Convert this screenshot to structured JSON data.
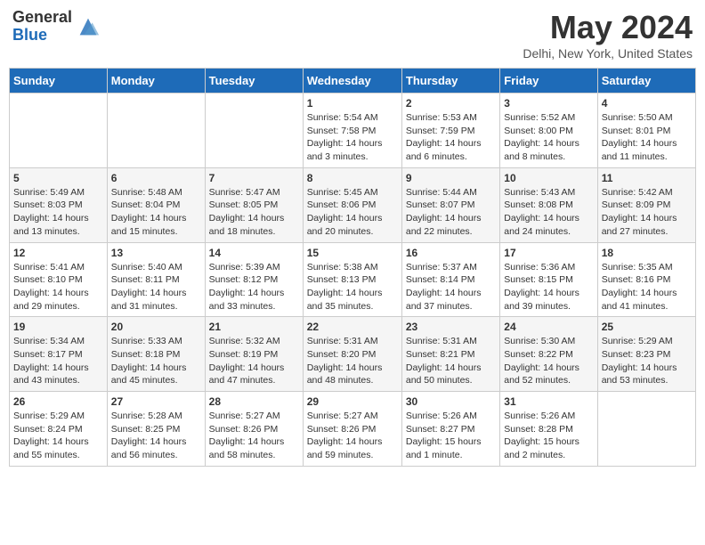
{
  "header": {
    "logo_general": "General",
    "logo_blue": "Blue",
    "month_title": "May 2024",
    "location": "Delhi, New York, United States"
  },
  "days_of_week": [
    "Sunday",
    "Monday",
    "Tuesday",
    "Wednesday",
    "Thursday",
    "Friday",
    "Saturday"
  ],
  "weeks": [
    [
      {
        "day": "",
        "info": ""
      },
      {
        "day": "",
        "info": ""
      },
      {
        "day": "",
        "info": ""
      },
      {
        "day": "1",
        "info": "Sunrise: 5:54 AM\nSunset: 7:58 PM\nDaylight: 14 hours\nand 3 minutes."
      },
      {
        "day": "2",
        "info": "Sunrise: 5:53 AM\nSunset: 7:59 PM\nDaylight: 14 hours\nand 6 minutes."
      },
      {
        "day": "3",
        "info": "Sunrise: 5:52 AM\nSunset: 8:00 PM\nDaylight: 14 hours\nand 8 minutes."
      },
      {
        "day": "4",
        "info": "Sunrise: 5:50 AM\nSunset: 8:01 PM\nDaylight: 14 hours\nand 11 minutes."
      }
    ],
    [
      {
        "day": "5",
        "info": "Sunrise: 5:49 AM\nSunset: 8:03 PM\nDaylight: 14 hours\nand 13 minutes."
      },
      {
        "day": "6",
        "info": "Sunrise: 5:48 AM\nSunset: 8:04 PM\nDaylight: 14 hours\nand 15 minutes."
      },
      {
        "day": "7",
        "info": "Sunrise: 5:47 AM\nSunset: 8:05 PM\nDaylight: 14 hours\nand 18 minutes."
      },
      {
        "day": "8",
        "info": "Sunrise: 5:45 AM\nSunset: 8:06 PM\nDaylight: 14 hours\nand 20 minutes."
      },
      {
        "day": "9",
        "info": "Sunrise: 5:44 AM\nSunset: 8:07 PM\nDaylight: 14 hours\nand 22 minutes."
      },
      {
        "day": "10",
        "info": "Sunrise: 5:43 AM\nSunset: 8:08 PM\nDaylight: 14 hours\nand 24 minutes."
      },
      {
        "day": "11",
        "info": "Sunrise: 5:42 AM\nSunset: 8:09 PM\nDaylight: 14 hours\nand 27 minutes."
      }
    ],
    [
      {
        "day": "12",
        "info": "Sunrise: 5:41 AM\nSunset: 8:10 PM\nDaylight: 14 hours\nand 29 minutes."
      },
      {
        "day": "13",
        "info": "Sunrise: 5:40 AM\nSunset: 8:11 PM\nDaylight: 14 hours\nand 31 minutes."
      },
      {
        "day": "14",
        "info": "Sunrise: 5:39 AM\nSunset: 8:12 PM\nDaylight: 14 hours\nand 33 minutes."
      },
      {
        "day": "15",
        "info": "Sunrise: 5:38 AM\nSunset: 8:13 PM\nDaylight: 14 hours\nand 35 minutes."
      },
      {
        "day": "16",
        "info": "Sunrise: 5:37 AM\nSunset: 8:14 PM\nDaylight: 14 hours\nand 37 minutes."
      },
      {
        "day": "17",
        "info": "Sunrise: 5:36 AM\nSunset: 8:15 PM\nDaylight: 14 hours\nand 39 minutes."
      },
      {
        "day": "18",
        "info": "Sunrise: 5:35 AM\nSunset: 8:16 PM\nDaylight: 14 hours\nand 41 minutes."
      }
    ],
    [
      {
        "day": "19",
        "info": "Sunrise: 5:34 AM\nSunset: 8:17 PM\nDaylight: 14 hours\nand 43 minutes."
      },
      {
        "day": "20",
        "info": "Sunrise: 5:33 AM\nSunset: 8:18 PM\nDaylight: 14 hours\nand 45 minutes."
      },
      {
        "day": "21",
        "info": "Sunrise: 5:32 AM\nSunset: 8:19 PM\nDaylight: 14 hours\nand 47 minutes."
      },
      {
        "day": "22",
        "info": "Sunrise: 5:31 AM\nSunset: 8:20 PM\nDaylight: 14 hours\nand 48 minutes."
      },
      {
        "day": "23",
        "info": "Sunrise: 5:31 AM\nSunset: 8:21 PM\nDaylight: 14 hours\nand 50 minutes."
      },
      {
        "day": "24",
        "info": "Sunrise: 5:30 AM\nSunset: 8:22 PM\nDaylight: 14 hours\nand 52 minutes."
      },
      {
        "day": "25",
        "info": "Sunrise: 5:29 AM\nSunset: 8:23 PM\nDaylight: 14 hours\nand 53 minutes."
      }
    ],
    [
      {
        "day": "26",
        "info": "Sunrise: 5:29 AM\nSunset: 8:24 PM\nDaylight: 14 hours\nand 55 minutes."
      },
      {
        "day": "27",
        "info": "Sunrise: 5:28 AM\nSunset: 8:25 PM\nDaylight: 14 hours\nand 56 minutes."
      },
      {
        "day": "28",
        "info": "Sunrise: 5:27 AM\nSunset: 8:26 PM\nDaylight: 14 hours\nand 58 minutes."
      },
      {
        "day": "29",
        "info": "Sunrise: 5:27 AM\nSunset: 8:26 PM\nDaylight: 14 hours\nand 59 minutes."
      },
      {
        "day": "30",
        "info": "Sunrise: 5:26 AM\nSunset: 8:27 PM\nDaylight: 15 hours\nand 1 minute."
      },
      {
        "day": "31",
        "info": "Sunrise: 5:26 AM\nSunset: 8:28 PM\nDaylight: 15 hours\nand 2 minutes."
      },
      {
        "day": "",
        "info": ""
      }
    ]
  ]
}
